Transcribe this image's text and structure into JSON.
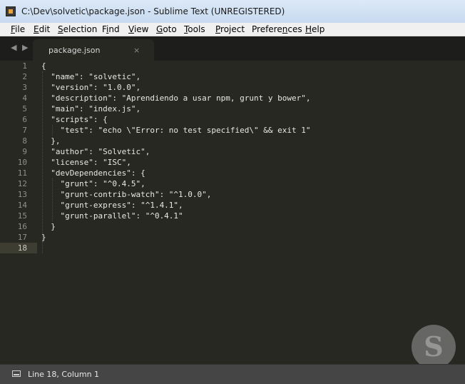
{
  "window": {
    "title": "C:\\Dev\\solvetic\\package.json - Sublime Text (UNREGISTERED)"
  },
  "menu": [
    {
      "m": "F",
      "r": "ile"
    },
    {
      "m": "E",
      "r": "dit"
    },
    {
      "m": "S",
      "r": "election"
    },
    {
      "p": "F",
      "m": "i",
      "r": "nd"
    },
    {
      "m": "V",
      "r": "iew"
    },
    {
      "m": "G",
      "r": "oto"
    },
    {
      "m": "T",
      "r": "ools"
    },
    {
      "m": "P",
      "r": "roject"
    },
    {
      "p": "Prefere",
      "m": "n",
      "r": "ces"
    },
    {
      "m": "H",
      "r": "elp"
    }
  ],
  "tabs": {
    "nav_left": "◀",
    "nav_right": "▶",
    "active_label": "package.json",
    "close": "×"
  },
  "code": {
    "line_numbers": [
      "1",
      "2",
      "3",
      "4",
      "5",
      "6",
      "7",
      "8",
      "9",
      "10",
      "11",
      "12",
      "13",
      "14",
      "15",
      "16",
      "17",
      "18"
    ],
    "lines": [
      "{",
      "  \"name\": \"solvetic\",",
      "  \"version\": \"1.0.0\",",
      "  \"description\": \"Aprendiendo a usar npm, grunt y bower\",",
      "  \"main\": \"index.js\",",
      "  \"scripts\": {",
      "    \"test\": \"echo \\\"Error: no test specified\\\" && exit 1\"",
      "  },",
      "  \"author\": \"Solvetic\",",
      "  \"license\": \"ISC\",",
      "  \"devDependencies\": {",
      "    \"grunt\": \"^0.4.5\",",
      "    \"grunt-contrib-watch\": \"^1.0.0\",",
      "    \"grunt-express\": \"^1.4.1\",",
      "    \"grunt-parallel\": \"^0.4.1\"",
      "  }",
      "}",
      ""
    ],
    "current_line": 18
  },
  "status": {
    "text": "Line 18, Column 1"
  },
  "watermark": {
    "icon": "solvetic-logo",
    "letter": "S"
  }
}
